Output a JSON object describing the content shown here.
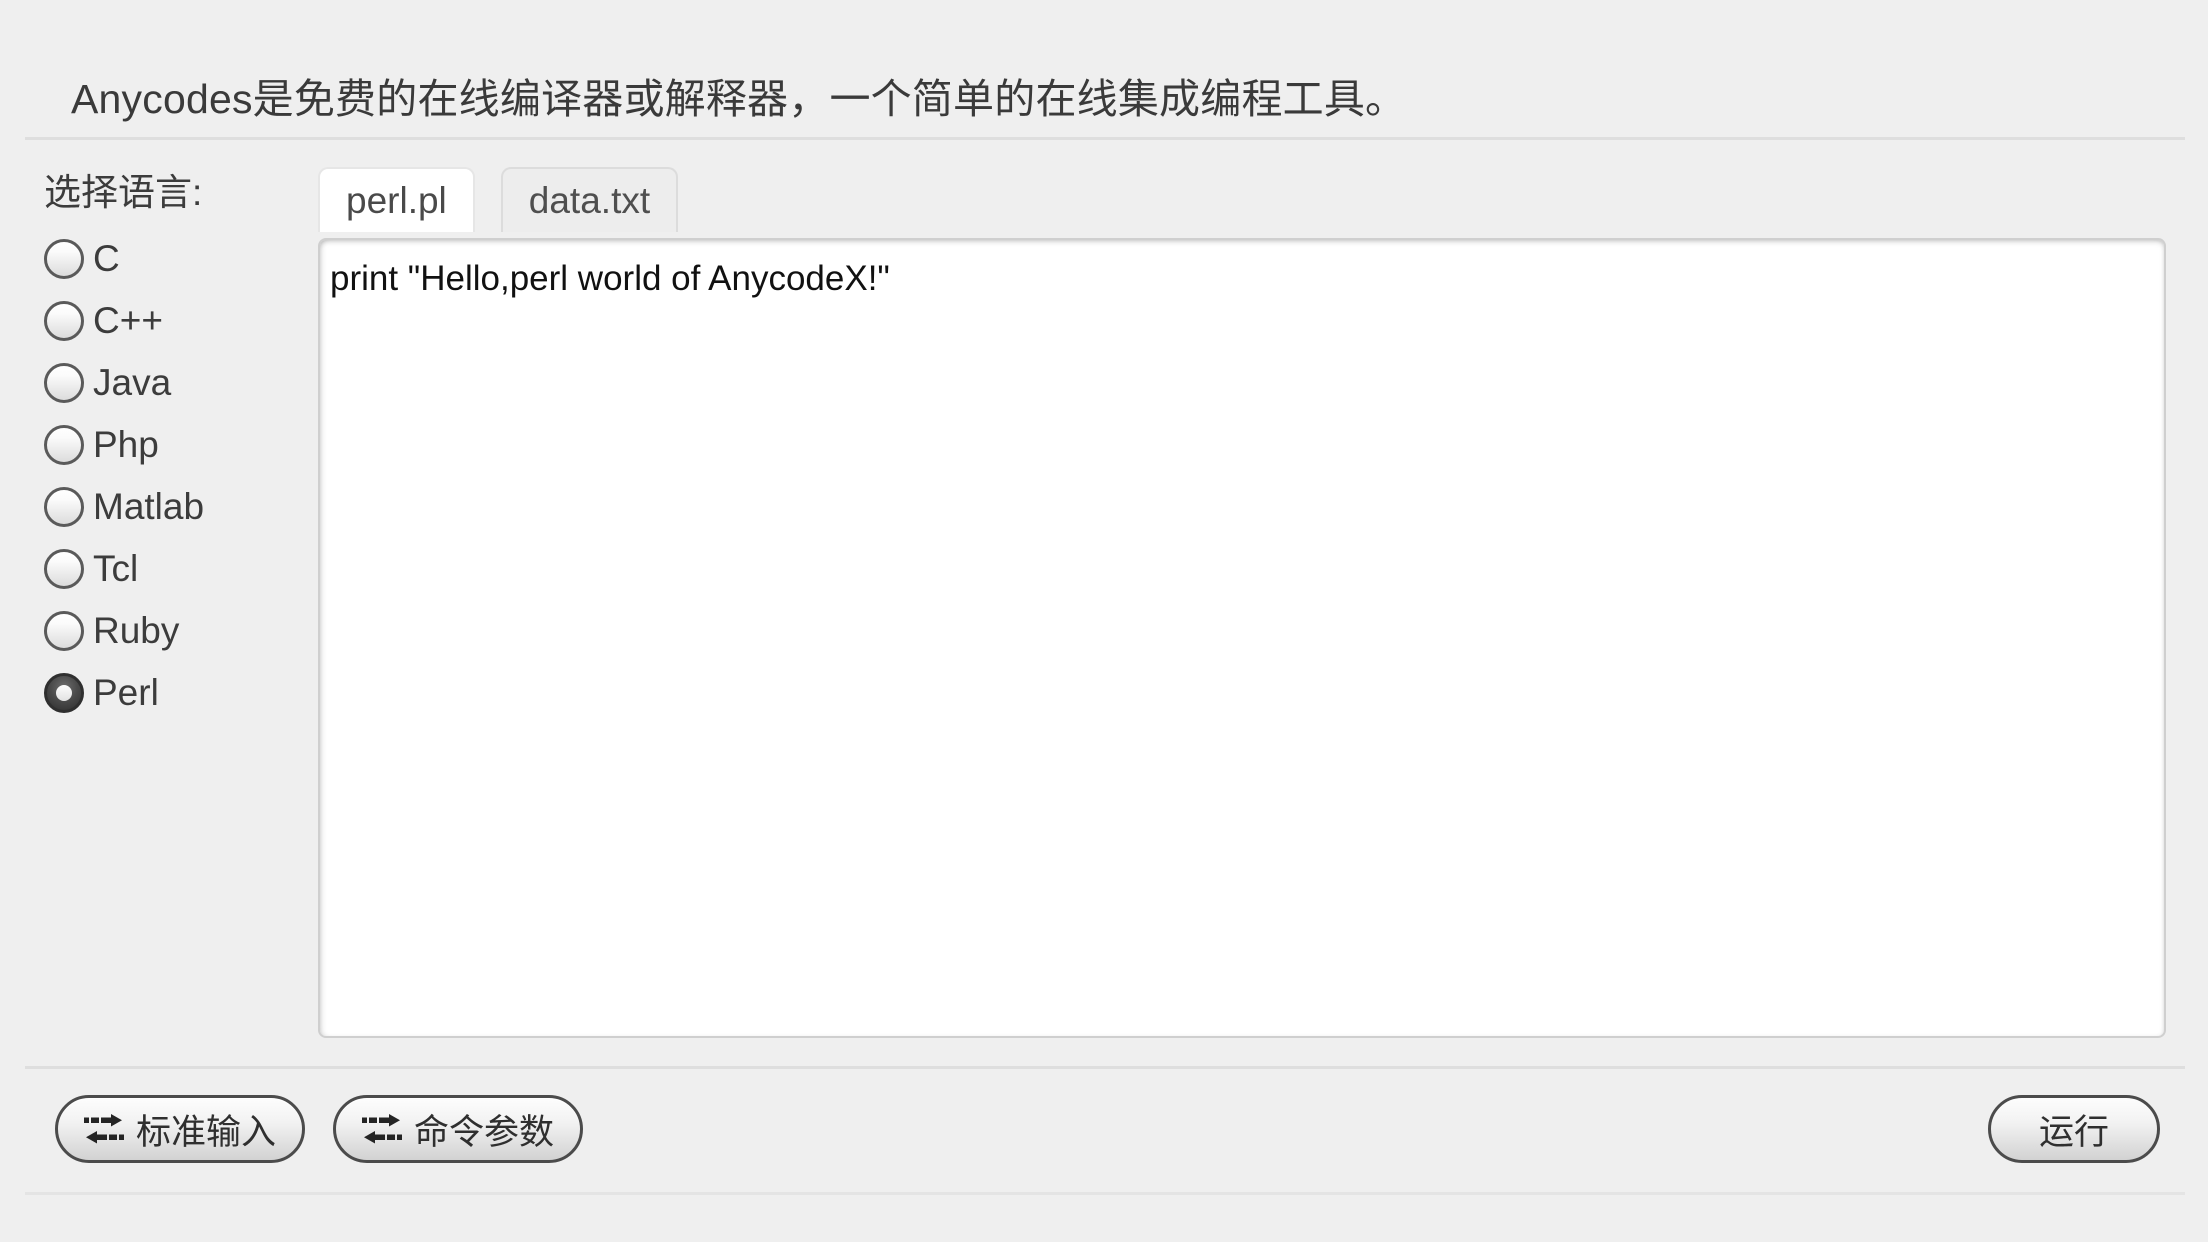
{
  "header": {
    "title": "Anycodes是免费的在线编译器或解释器，一个简单的在线集成编程工具。"
  },
  "language_panel": {
    "label": "选择语言:",
    "options": [
      {
        "label": "C",
        "selected": false
      },
      {
        "label": "C++",
        "selected": false
      },
      {
        "label": "Java",
        "selected": false
      },
      {
        "label": "Php",
        "selected": false
      },
      {
        "label": "Matlab",
        "selected": false
      },
      {
        "label": "Tcl",
        "selected": false
      },
      {
        "label": "Ruby",
        "selected": false
      },
      {
        "label": "Perl",
        "selected": true
      }
    ],
    "selected_value": "Perl"
  },
  "tabs": [
    {
      "label": "perl.pl",
      "active": true
    },
    {
      "label": "data.txt",
      "active": false
    }
  ],
  "editor": {
    "code": "print \"Hello,perl world of AnycodeX!\"",
    "placeholder": ""
  },
  "toolbar": {
    "stdin_label": "标准输入",
    "stdin_icon": "transfer-arrows-icon",
    "args_label": "命令参数",
    "args_icon": "transfer-arrows-icon",
    "run_label": "运行"
  },
  "colors": {
    "page_background": "#efefef",
    "divider": "#dedede",
    "editor_background": "#ffffff",
    "editor_border": "#cfcfcf",
    "text": "#3a3a3a",
    "button_border": "#4b4b4b"
  }
}
